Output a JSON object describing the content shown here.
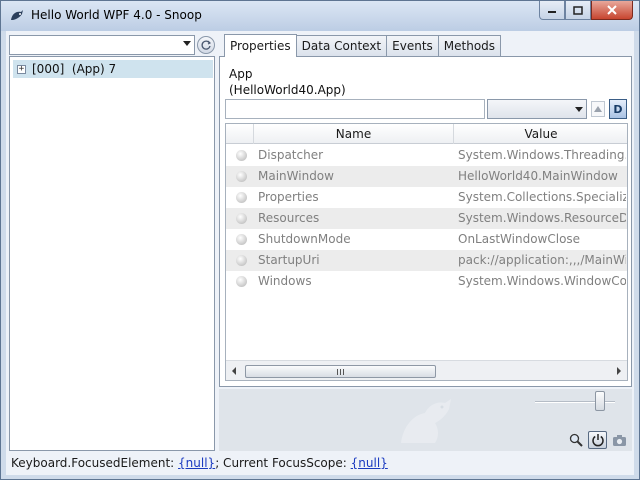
{
  "window": {
    "title": "Hello World WPF 4.0 - Snoop"
  },
  "left": {
    "combo_value": "",
    "tree": [
      {
        "expander": "+",
        "label": "[000]  (App) 7",
        "selected": true
      }
    ]
  },
  "tabs": [
    {
      "label": "Properties",
      "active": true
    },
    {
      "label": "Data Context",
      "active": false
    },
    {
      "label": "Events",
      "active": false
    },
    {
      "label": "Methods",
      "active": false
    }
  ],
  "properties": {
    "object_name": "App",
    "object_type": "(HelloWorld40.App)",
    "filter_value": "",
    "filter_combo_value": "",
    "d_button_label": "D",
    "columns": {
      "name": "Name",
      "value": "Value"
    },
    "rows": [
      {
        "name": "Dispatcher",
        "value": "System.Windows.Threading.Dis"
      },
      {
        "name": "MainWindow",
        "value": "HelloWorld40.MainWindow"
      },
      {
        "name": "Properties",
        "value": "System.Collections.Specialized."
      },
      {
        "name": "Resources",
        "value": "System.Windows.ResourceDicti"
      },
      {
        "name": "ShutdownMode",
        "value": "OnLastWindowClose"
      },
      {
        "name": "StartupUri",
        "value": "pack://application:,,,/MainWind"
      },
      {
        "name": "Windows",
        "value": "System.Windows.WindowColle"
      }
    ]
  },
  "status": {
    "focused_label": "Keyboard.FocusedElement:",
    "focused_value": "{null}",
    "scope_label": "; Current FocusScope:",
    "scope_value": "{null}"
  },
  "icons": {
    "app": "snoop-logo-icon",
    "refresh": "refresh-icon",
    "zoom": "magnifier-icon",
    "power": "power-icon",
    "camera": "camera-icon"
  }
}
